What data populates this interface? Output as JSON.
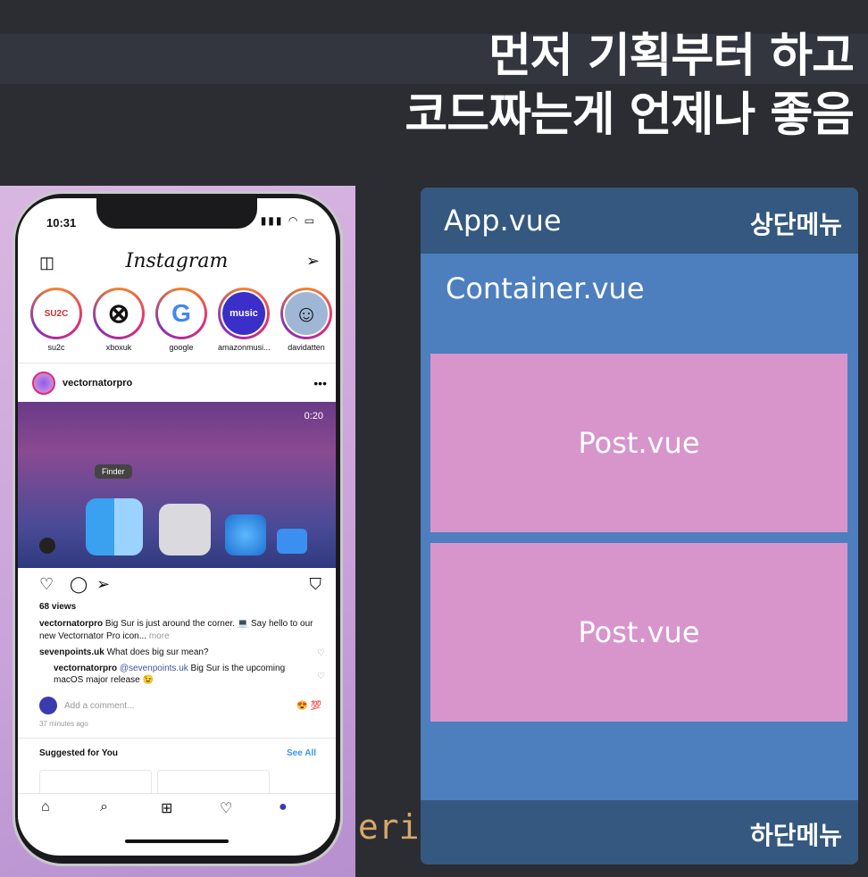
{
  "slide": {
    "title_line1": "먼저 기획부터 하고",
    "title_line2": "코드짜는게 언제나 좋음",
    "bg_code_text": "seri"
  },
  "phone": {
    "status_time": "10:31",
    "status_icons": "▮▮▮ ◠ ▭",
    "app_logo": "Instagram",
    "stories": [
      {
        "name": "su2c",
        "glyph": "SU2C"
      },
      {
        "name": "xboxuk",
        "glyph": "⊗"
      },
      {
        "name": "google",
        "glyph": "G"
      },
      {
        "name": "amazonmusi...",
        "glyph": "music"
      },
      {
        "name": "davidatten",
        "glyph": "☺"
      }
    ],
    "post": {
      "username": "vectornatorpro",
      "more": "•••",
      "media_time": "0:20",
      "finder_tooltip": "Finder",
      "views": "68 views",
      "caption_user": "vectornatorpro",
      "caption_text": " Big Sur is just around the corner. 💻 Say hello to our new Vectornator Pro icon...",
      "caption_more": " more",
      "comment1_user": "sevenpoints.uk",
      "comment1_text": " What does big sur mean?",
      "reply_user": "vectornatorpro",
      "reply_mention": " @sevenpoints.uk",
      "reply_text": " Big Sur is the upcoming macOS major release 😉",
      "add_comment_placeholder": "Add a comment...",
      "comment_emojis": "😍  💯",
      "time_ago": "37 minutes ago"
    },
    "suggested": {
      "title": "Suggested for You",
      "see_all": "See All"
    },
    "icons": {
      "camera": "◫",
      "send": "➢",
      "heart": "♡",
      "comment": "◯",
      "share": "➢",
      "bookmark": "⛉",
      "home": "⌂",
      "search": "⌕",
      "add": "⊞",
      "activity": "♡",
      "profile": "●"
    }
  },
  "diagram": {
    "app_label": "App.vue",
    "top_menu": "상단메뉴",
    "container_label": "Container.vue",
    "posts": [
      "Post.vue",
      "Post.vue"
    ],
    "bottom_menu": "하단메뉴",
    "colors": {
      "container": "#4d7fbf",
      "bar": "#34587f",
      "post": "#d795cc"
    }
  }
}
